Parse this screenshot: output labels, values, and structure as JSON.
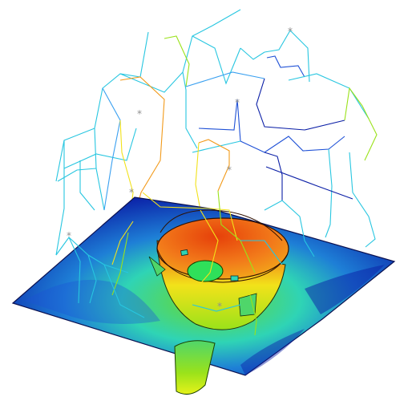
{
  "viewport": {
    "background": "#ffffff"
  },
  "colormap": {
    "low": "#0a1ea6",
    "low_mid": "#1e7fd6",
    "mid": "#2fd4b5",
    "mid_high": "#9ae21a",
    "high_mid": "#f2e21a",
    "high": "#e6400a"
  },
  "scene": {
    "surface_name": "deformed-surface",
    "part_name": "molded-part",
    "wireframe_name": "mesh-wireframe",
    "marker_glyph": "*"
  }
}
